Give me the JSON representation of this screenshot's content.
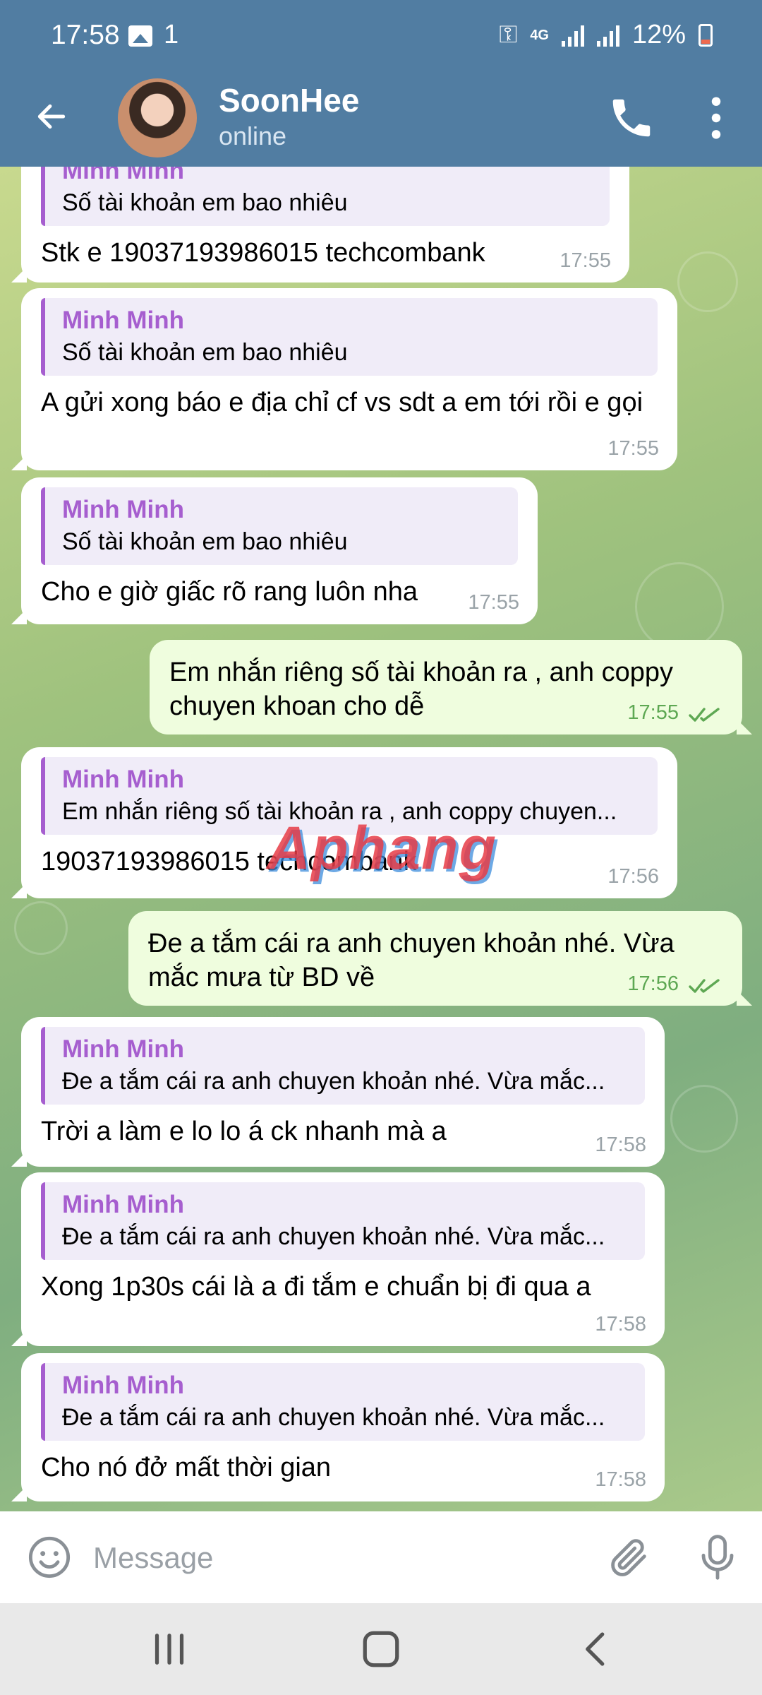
{
  "status_bar": {
    "time": "17:58",
    "notif_count": "1",
    "network": "4G",
    "battery": "12%",
    "battery_level": 0.12
  },
  "header": {
    "name": "SoonHee",
    "status": "online"
  },
  "colors": {
    "header_bg": "#517da2",
    "outgoing_bubble": "#effdde",
    "incoming_bubble": "#ffffff",
    "reply_accent": "#a65ecf",
    "read_check": "#5ea853"
  },
  "messages": [
    {
      "dir": "in",
      "reply_name": "Minh Minh",
      "reply_text": "Số tài khoản em bao nhiêu",
      "text": "Stk e 19037193986015 techcombank",
      "time": "17:55"
    },
    {
      "dir": "in",
      "reply_name": "Minh Minh",
      "reply_text": "Số tài khoản em bao nhiêu",
      "text": "A gửi xong báo e địa chỉ cf vs sdt a em tới rồi e gọi",
      "time": "17:55"
    },
    {
      "dir": "in",
      "reply_name": "Minh Minh",
      "reply_text": "Số tài khoản em bao nhiêu",
      "text": "Cho e giờ giấc rõ rang luôn nha",
      "time": "17:55"
    },
    {
      "dir": "out",
      "text": "Em nhắn riêng số tài khoản ra , anh coppy chuyen khoan cho dễ",
      "time": "17:55",
      "read": true
    },
    {
      "dir": "in",
      "reply_name": "Minh Minh",
      "reply_text": "Em nhắn riêng số tài khoản ra , anh coppy chuyen...",
      "text": "19037193986015 techcombank",
      "time": "17:56"
    },
    {
      "dir": "out",
      "text": "Đe a tắm cái ra anh chuyen khoản nhé. Vừa mắc mưa từ BD về",
      "time": "17:56",
      "read": true
    },
    {
      "dir": "in",
      "reply_name": "Minh Minh",
      "reply_text": "Đe a tắm cái ra anh chuyen khoản nhé. Vừa mắc...",
      "text": "Trời a làm e lo lo á ck nhanh mà a",
      "time": "17:58"
    },
    {
      "dir": "in",
      "reply_name": "Minh Minh",
      "reply_text": "Đe a tắm cái ra anh chuyen khoản nhé. Vừa mắc...",
      "text": "Xong 1p30s cái là a đi tắm e chuẩn bị đi qua a",
      "time": "17:58"
    },
    {
      "dir": "in",
      "reply_name": "Minh Minh",
      "reply_text": "Đe a tắm cái ra anh chuyen khoản nhé. Vừa mắc...",
      "text": "Cho nó đở mất thời gian",
      "time": "17:58"
    }
  ],
  "watermark": "Aphang",
  "input": {
    "placeholder": "Message",
    "value": ""
  },
  "icons": {
    "back": "arrow-left-icon",
    "call": "phone-icon",
    "more": "more-vertical-icon",
    "emoji": "smile-icon",
    "attach": "paperclip-icon",
    "mic": "microphone-icon",
    "nav_recents": "recents-icon",
    "nav_home": "home-icon",
    "nav_back": "chevron-left-icon"
  }
}
